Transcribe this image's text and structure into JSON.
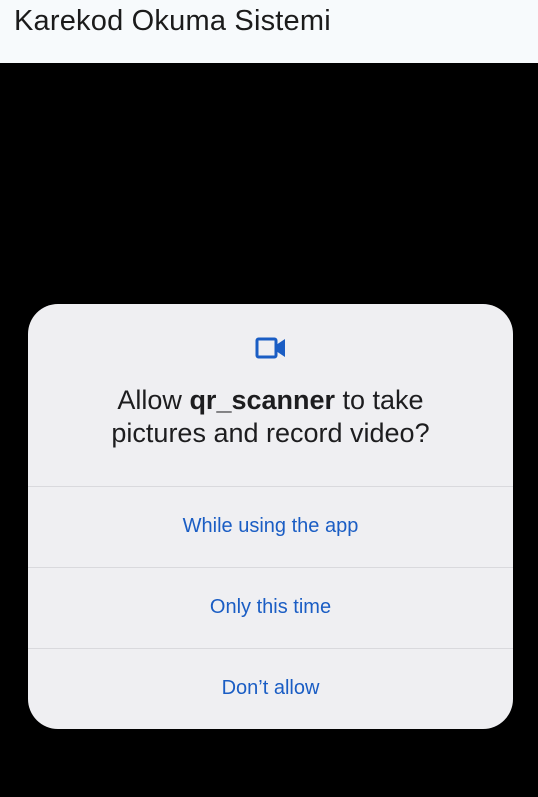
{
  "app_bar": {
    "title": "Karekod Okuma Sistemi"
  },
  "permission_dialog": {
    "icon": "videocam-icon",
    "message_prefix": "Allow ",
    "app_name": "qr_scanner",
    "message_suffix_line1": " to take",
    "message_line2": "pictures and record video?",
    "options": [
      {
        "label": "While using the app"
      },
      {
        "label": "Only this time"
      },
      {
        "label": "Don’t allow"
      }
    ]
  },
  "colors": {
    "accent": "#1a5dc4",
    "dialog_bg": "#efeff2",
    "app_bar_bg": "#f7fafc",
    "backdrop": "#000000"
  }
}
